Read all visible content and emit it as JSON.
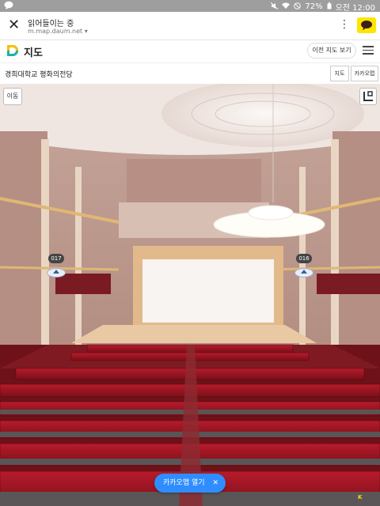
{
  "statusbar": {
    "notification_icon": "chat-bubble-icon",
    "battery": "72%",
    "time": "오전 12:00",
    "icons": [
      "mute-icon",
      "wifi-icon",
      "dnd-icon",
      "battery-icon"
    ]
  },
  "browser": {
    "title": "읽어들이는 중",
    "url": "m.map.daum.net",
    "close_icon": "close-icon",
    "menu_icon": "kebab-icon",
    "talk_icon": "kakaotalk-icon"
  },
  "header": {
    "title": "지도",
    "prev_map": "이전 지도 보기",
    "menu_icon": "hamburger-icon",
    "accent": "#fee500"
  },
  "place": {
    "name": "경희대학교 평화의전당",
    "map_button": "지도",
    "kakaomap_button": "카카오맵 >"
  },
  "viewer": {
    "move_button": "이동",
    "minimap_icon": "minimap-toggle-icon",
    "pins": [
      {
        "label": "017"
      },
      {
        "label": "016"
      }
    ],
    "open_app": "카카오맵 열기",
    "open_app_close": "✕",
    "accent": "#2f8dff"
  }
}
